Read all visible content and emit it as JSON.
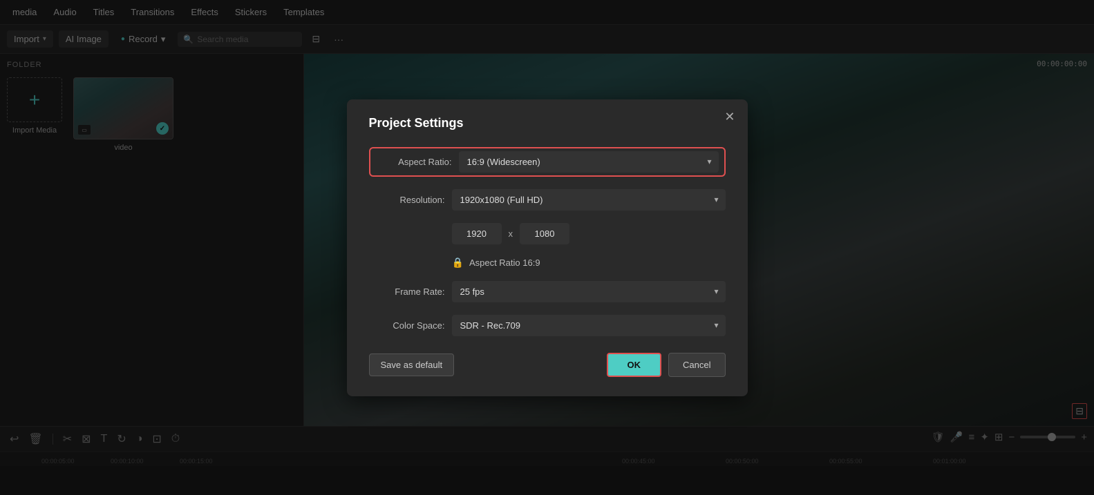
{
  "topMenu": {
    "items": [
      "media",
      "Audio",
      "Titles",
      "Transitions",
      "Effects",
      "Stickers",
      "Templates"
    ]
  },
  "toolbar": {
    "import_label": "Import",
    "ai_image_label": "AI Image",
    "record_label": "Record",
    "search_placeholder": "Search media",
    "filter_icon": "⊟",
    "more_icon": "···"
  },
  "leftPanel": {
    "folder_label": "FOLDER",
    "import_label": "Import Media",
    "video_label": "video"
  },
  "dialog": {
    "title": "Project Settings",
    "aspect_ratio_label": "Aspect Ratio:",
    "aspect_ratio_value": "16:9 (Widescreen)",
    "resolution_label": "Resolution:",
    "resolution_value": "1920x1080 (Full HD)",
    "width_value": "1920",
    "height_value": "1080",
    "lock_label": "Aspect Ratio 16:9",
    "frame_rate_label": "Frame Rate:",
    "frame_rate_value": "25 fps",
    "color_space_label": "Color Space:",
    "color_space_value": "SDR - Rec.709",
    "save_default_label": "Save as default",
    "ok_label": "OK",
    "cancel_label": "Cancel"
  },
  "timeline": {
    "time_code": "00:00:00:00",
    "ruler_marks": [
      "00:00:05:00",
      "00:00:10:00",
      "00:00:15:00",
      "00:00:45:00",
      "00:00:50:00",
      "00:00:55:00",
      "00:01:00:00"
    ]
  },
  "preview": {
    "time_code": "00:00:00:00"
  }
}
